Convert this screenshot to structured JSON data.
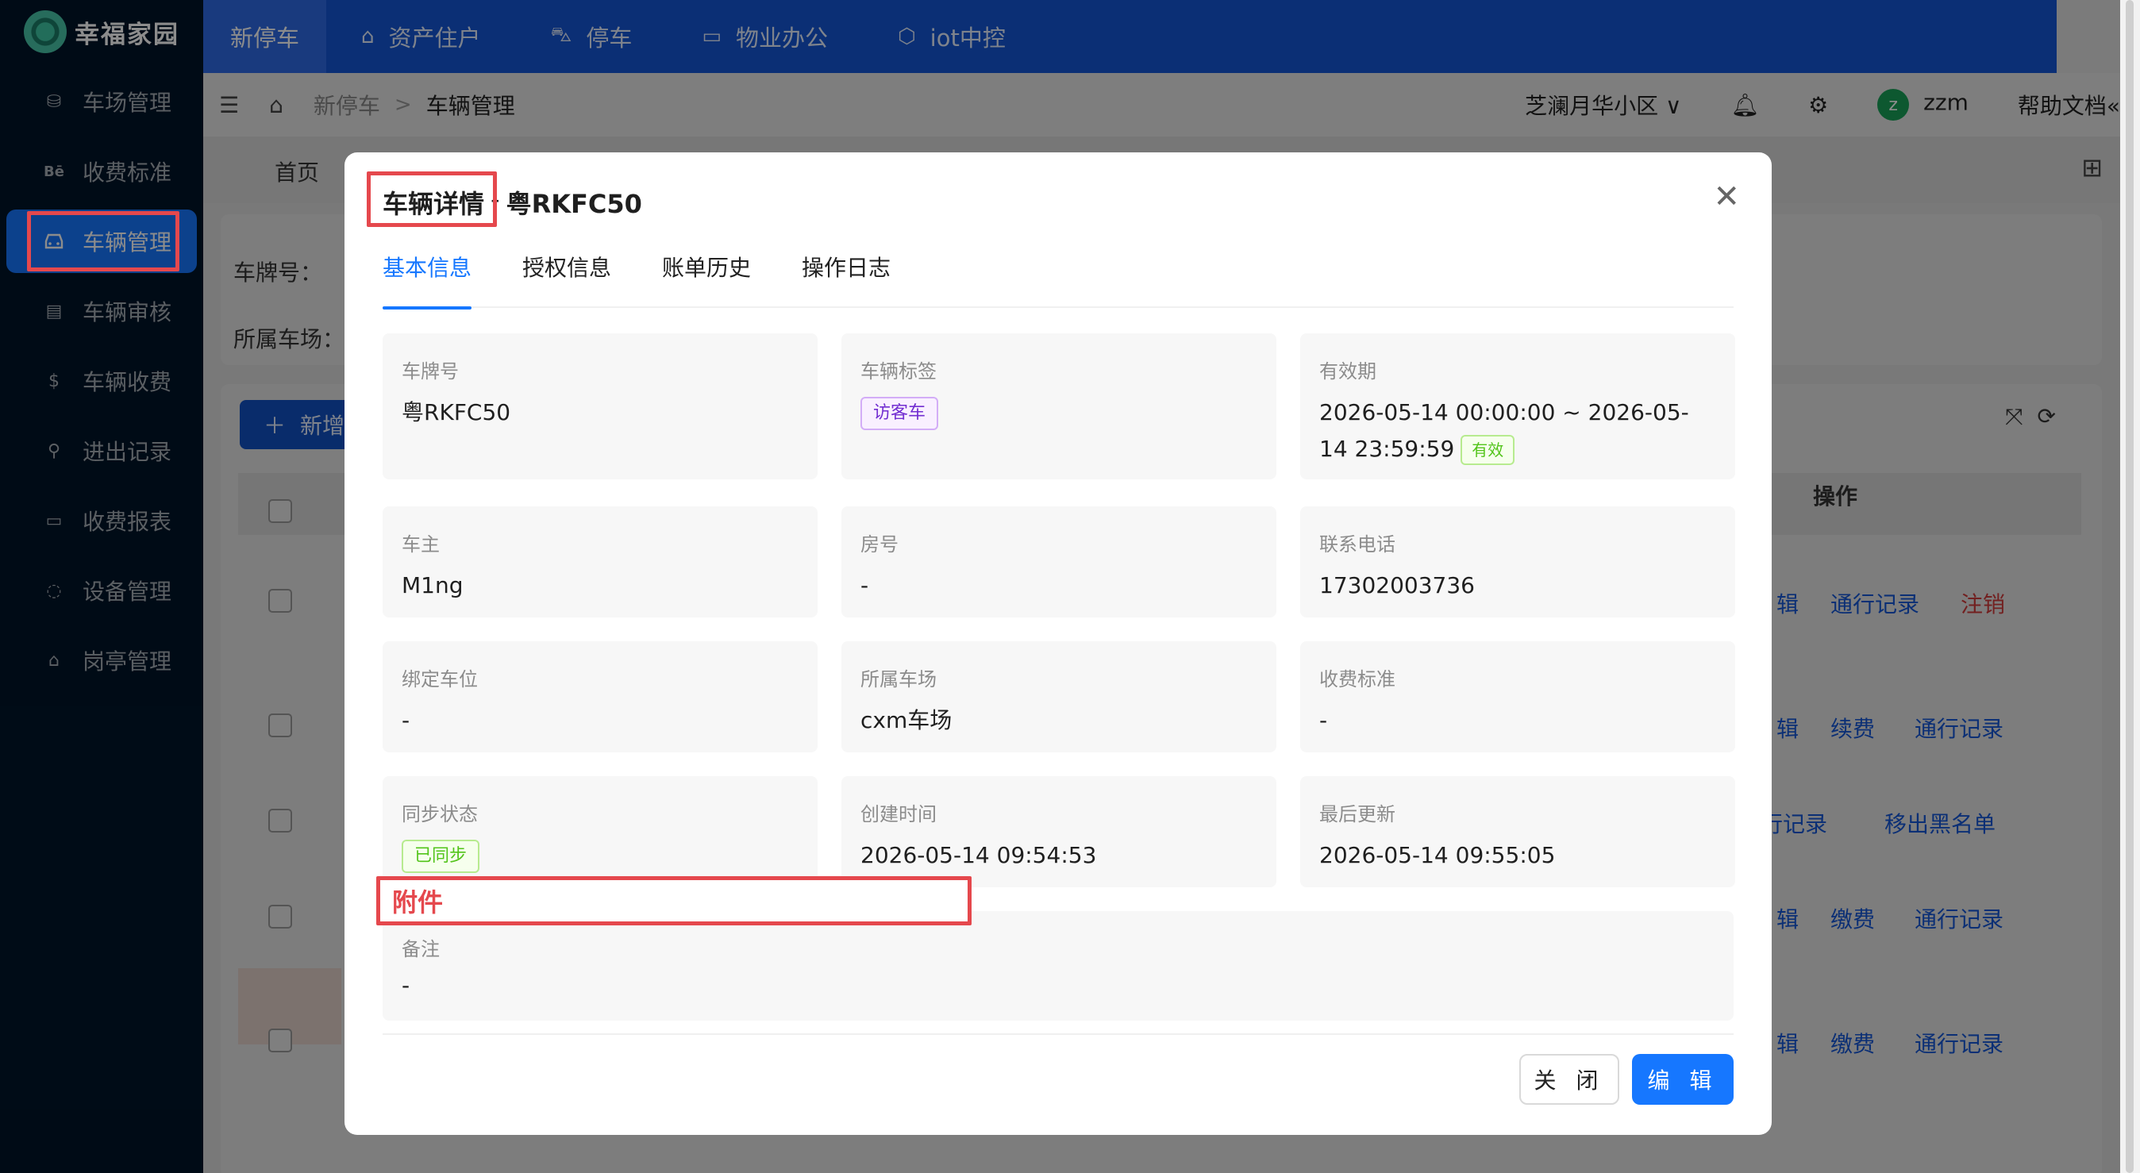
{
  "app": {
    "logo_text": "幸福家园"
  },
  "sidebar": {
    "items": [
      {
        "label": "车场管理",
        "icon": "parking-icon"
      },
      {
        "label": "收费标准",
        "icon": "be-icon"
      },
      {
        "label": "车辆管理",
        "icon": "car-icon",
        "active": true
      },
      {
        "label": "车辆审核",
        "icon": "audit-icon"
      },
      {
        "label": "车辆收费",
        "icon": "dollar-icon"
      },
      {
        "label": "进出记录",
        "icon": "route-icon"
      },
      {
        "label": "收费报表",
        "icon": "report-icon"
      },
      {
        "label": "设备管理",
        "icon": "device-icon"
      },
      {
        "label": "岗亭管理",
        "icon": "booth-icon"
      }
    ]
  },
  "topnav": {
    "tabs": [
      {
        "label": "新停车",
        "active": true
      },
      {
        "label": "资产住户",
        "icon": "home-icon"
      },
      {
        "label": "停车",
        "icon": "car-icon"
      },
      {
        "label": "物业办公",
        "icon": "laptop-icon"
      },
      {
        "label": "iot中控",
        "icon": "cube-icon"
      }
    ]
  },
  "header": {
    "breadcrumb": [
      "新停车",
      "车辆管理"
    ],
    "community": "芝澜月华小区",
    "user": "zzm",
    "avatar_letter": "z",
    "help": "帮助文档"
  },
  "page_tabs": {
    "home": "首页"
  },
  "filters": {
    "plate_label": "车牌号：",
    "lot_label": "所属车场："
  },
  "table": {
    "add_button": "新增",
    "op_header": "操作",
    "rows": [
      {
        "links": [
          "辑",
          "通行记录",
          "注销"
        ]
      },
      {
        "links": [
          "辑",
          "续费",
          "通行记录"
        ]
      },
      {
        "links": [
          "行记录",
          "移出黑名单"
        ]
      },
      {
        "links": [
          "辑",
          "缴费",
          "通行记录"
        ]
      },
      {
        "links": [
          "辑",
          "缴费",
          "通行记录"
        ]
      }
    ]
  },
  "modal": {
    "title": "车辆详情",
    "title_sep": "-",
    "plate": "粤RKFC50",
    "tabs": [
      "基本信息",
      "授权信息",
      "账单历史",
      "操作日志"
    ],
    "fields": {
      "plate": {
        "label": "车牌号",
        "value": "粤RKFC50"
      },
      "vehicle_tag": {
        "label": "车辆标签",
        "value": "访客车"
      },
      "validity": {
        "label": "有效期",
        "value": "2026-05-14 00:00:00 ~ 2026-05-14 23:59:59",
        "status": "有效"
      },
      "owner": {
        "label": "车主",
        "value": "M1ng"
      },
      "room": {
        "label": "房号",
        "value": "-"
      },
      "phone": {
        "label": "联系电话",
        "value": "17302003736"
      },
      "bound_space": {
        "label": "绑定车位",
        "value": "-"
      },
      "parking_lot": {
        "label": "所属车场",
        "value": "cxm车场"
      },
      "fee_standard": {
        "label": "收费标准",
        "value": "-"
      },
      "sync_status": {
        "label": "同步状态",
        "value": "已同步"
      },
      "created": {
        "label": "创建时间",
        "value": "2026-05-14 09:54:53"
      },
      "updated": {
        "label": "最后更新",
        "value": "2026-05-14 09:55:05"
      }
    },
    "attachment_label": "附件",
    "remark": {
      "label": "备注",
      "value": "-"
    },
    "buttons": {
      "close": "关 闭",
      "edit": "编 辑"
    }
  },
  "colors": {
    "primary": "#1677ff",
    "sidebar_bg": "#001529",
    "topbar": "#1456d6",
    "highlight": "#e5484d"
  }
}
